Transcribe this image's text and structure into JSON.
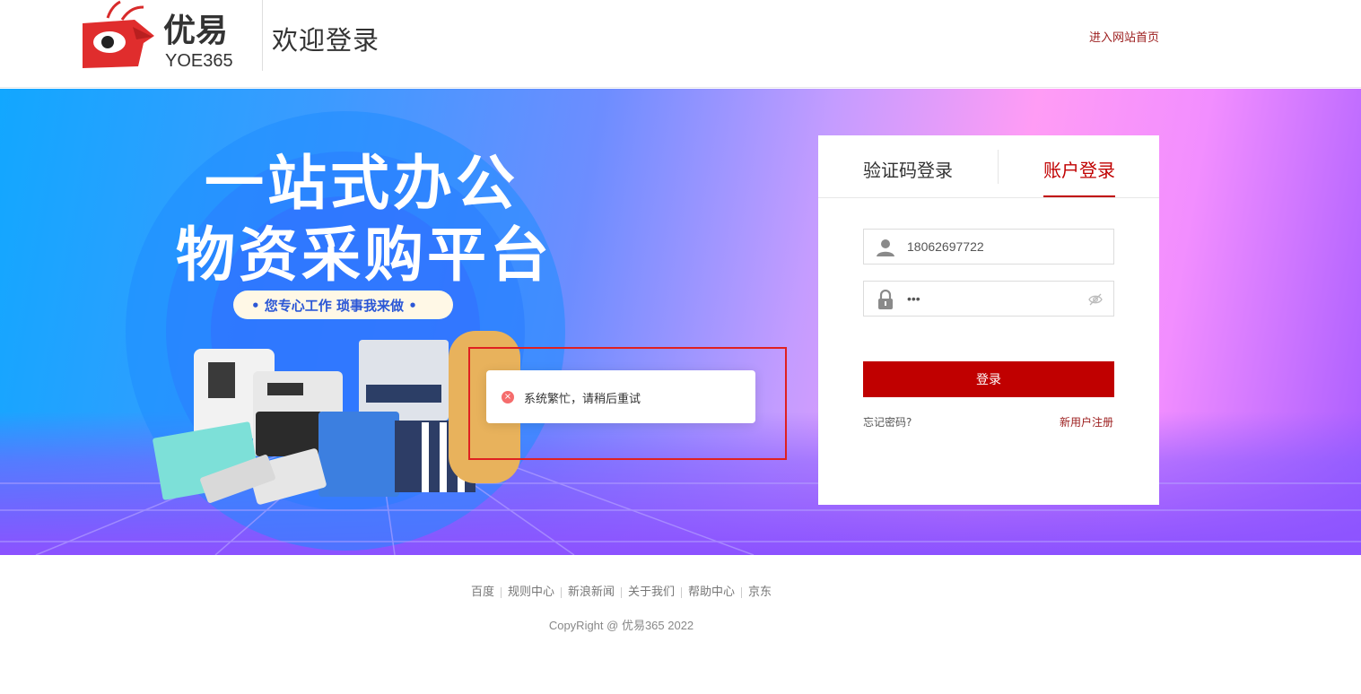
{
  "header": {
    "brand_cn": "优易",
    "brand_en": "YOE365",
    "welcome": "欢迎登录",
    "home_link": "进入网站首页"
  },
  "banner": {
    "headline_line1": "一站式办公",
    "headline_line2": "物资采购平台",
    "slogan": "• 您专心工作  琐事我来做 •"
  },
  "login": {
    "tabs": [
      {
        "label": "验证码登录",
        "active": false
      },
      {
        "label": "账户登录",
        "active": true
      }
    ],
    "username_value": "18062697722",
    "password_mask": "•••",
    "submit_label": "登录",
    "forgot_label": "忘记密码?",
    "register_label": "新用户注册"
  },
  "toast": {
    "type": "error",
    "message": "系统繁忙，请稍后重试"
  },
  "footer": {
    "links": [
      "百度",
      "规则中心",
      "新浪新闻",
      "关于我们",
      "帮助中心",
      "京东"
    ],
    "copyright": "CopyRight @ 优易365 2022"
  },
  "colors": {
    "brand_red": "#c00000",
    "link_dark_red": "#9b1b1b",
    "error_red": "#f56c6c"
  }
}
